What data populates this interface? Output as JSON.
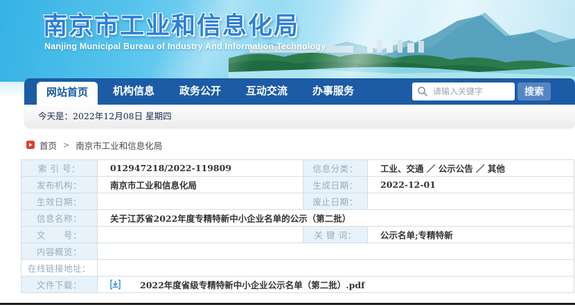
{
  "banner": {
    "title": "南京市工业和信息化局",
    "subtitle": "Nanjing Municipal Bureau of Industry And Information Technology"
  },
  "nav": {
    "tabs": [
      {
        "label": "网站首页",
        "active": true
      },
      {
        "label": "机构信息",
        "active": false
      },
      {
        "label": "政务公开",
        "active": false
      },
      {
        "label": "互动交流",
        "active": false
      },
      {
        "label": "办事服务",
        "active": false
      }
    ],
    "search": {
      "placeholder": "请输入关键字",
      "button_label": "搜索"
    }
  },
  "date_bar": {
    "text": "今天是：2022年12月08日 星期四"
  },
  "breadcrumb": {
    "home": "首页",
    "separator": ">",
    "current": "南京市工业和信息化局"
  },
  "info_table": {
    "index_label": "索 引 号：",
    "index_value": "012947218/2022-119809",
    "category_label": "信息分类：",
    "category_value": "工业、交通 ／ 公示公告 ／ 其他",
    "publisher_label": "发布机构：",
    "publisher_value": "南京市工业和信息化局",
    "gen_date_label": "生成日期：",
    "gen_date_value": "2022-12-01",
    "effective_label": "生效日期：",
    "effective_value": "",
    "expire_label": "废止日期：",
    "expire_value": "",
    "name_label": "信息名称：",
    "name_value": "关于江苏省2022年度专精特新中小企业名单的公示（第二批）",
    "doc_no_label": "文　　号：",
    "doc_no_value": "",
    "keywords_label": "关 键 词：",
    "keywords_value": "公示名单;专精特新",
    "overview_label": "内容概览：",
    "overview_value": "",
    "link_label": "在线链接地址：",
    "link_value": "",
    "download_label": "文件下载：",
    "download_filename": "2022年度省级专精特新中小企业公示名单（第二批）.pdf"
  },
  "icons": {
    "search_icon": "magnifier glyph",
    "home_icon": "red square with white arrow",
    "download_icon": "blue brackets with down arrow"
  },
  "colors": {
    "nav_blue": "#1c5ba6",
    "search_button_bg": "#5586c2",
    "label_cell_bg": "#e7f2fb",
    "label_text": "#9cabbc",
    "value_text": "#333333",
    "banner_title_blue": "#2b80d9",
    "breadcrumb_icon_red": "#e03c31",
    "download_icon_blue": "#3a8ee6"
  }
}
